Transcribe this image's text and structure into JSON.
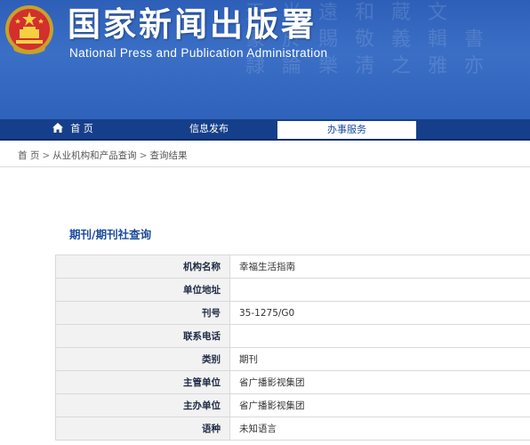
{
  "header": {
    "title_zh": "国家新闻出版署",
    "title_en": "National  Press and Publication Administration",
    "emblem_icon": "national-emblem-icon",
    "background_calligraphy": [
      "天 光 遠 和 蔵 文",
      "篆 於 賜 敬 義 輯 書",
      "隷 論 樂 淸 之 雅 亦"
    ]
  },
  "nav": {
    "items": [
      {
        "label": "首 页",
        "icon": "home-icon"
      },
      {
        "label": "信息发布"
      },
      {
        "label": "办事服务",
        "active": true
      }
    ]
  },
  "breadcrumb": {
    "items": [
      "首 页",
      "从业机构和产品查询",
      "查询结果"
    ],
    "separator": ">"
  },
  "section": {
    "title": "期刊/期刊社查询"
  },
  "record": {
    "rows": [
      {
        "label": "机构名称",
        "value": "幸福生活指南"
      },
      {
        "label": "单位地址",
        "value": ""
      },
      {
        "label": "刊号",
        "value": "35-1275/G0"
      },
      {
        "label": "联系电话",
        "value": ""
      },
      {
        "label": "类别",
        "value": "期刊"
      },
      {
        "label": "主管单位",
        "value": "省广播影视集团"
      },
      {
        "label": "主办单位",
        "value": "省广播影视集团"
      },
      {
        "label": "语种",
        "value": "未知语言"
      }
    ]
  },
  "colors": {
    "banner": "#3b6fc6",
    "nav": "#153f8a",
    "accent_text": "#1a4b9c",
    "label_bg": "#f2f2f2"
  }
}
